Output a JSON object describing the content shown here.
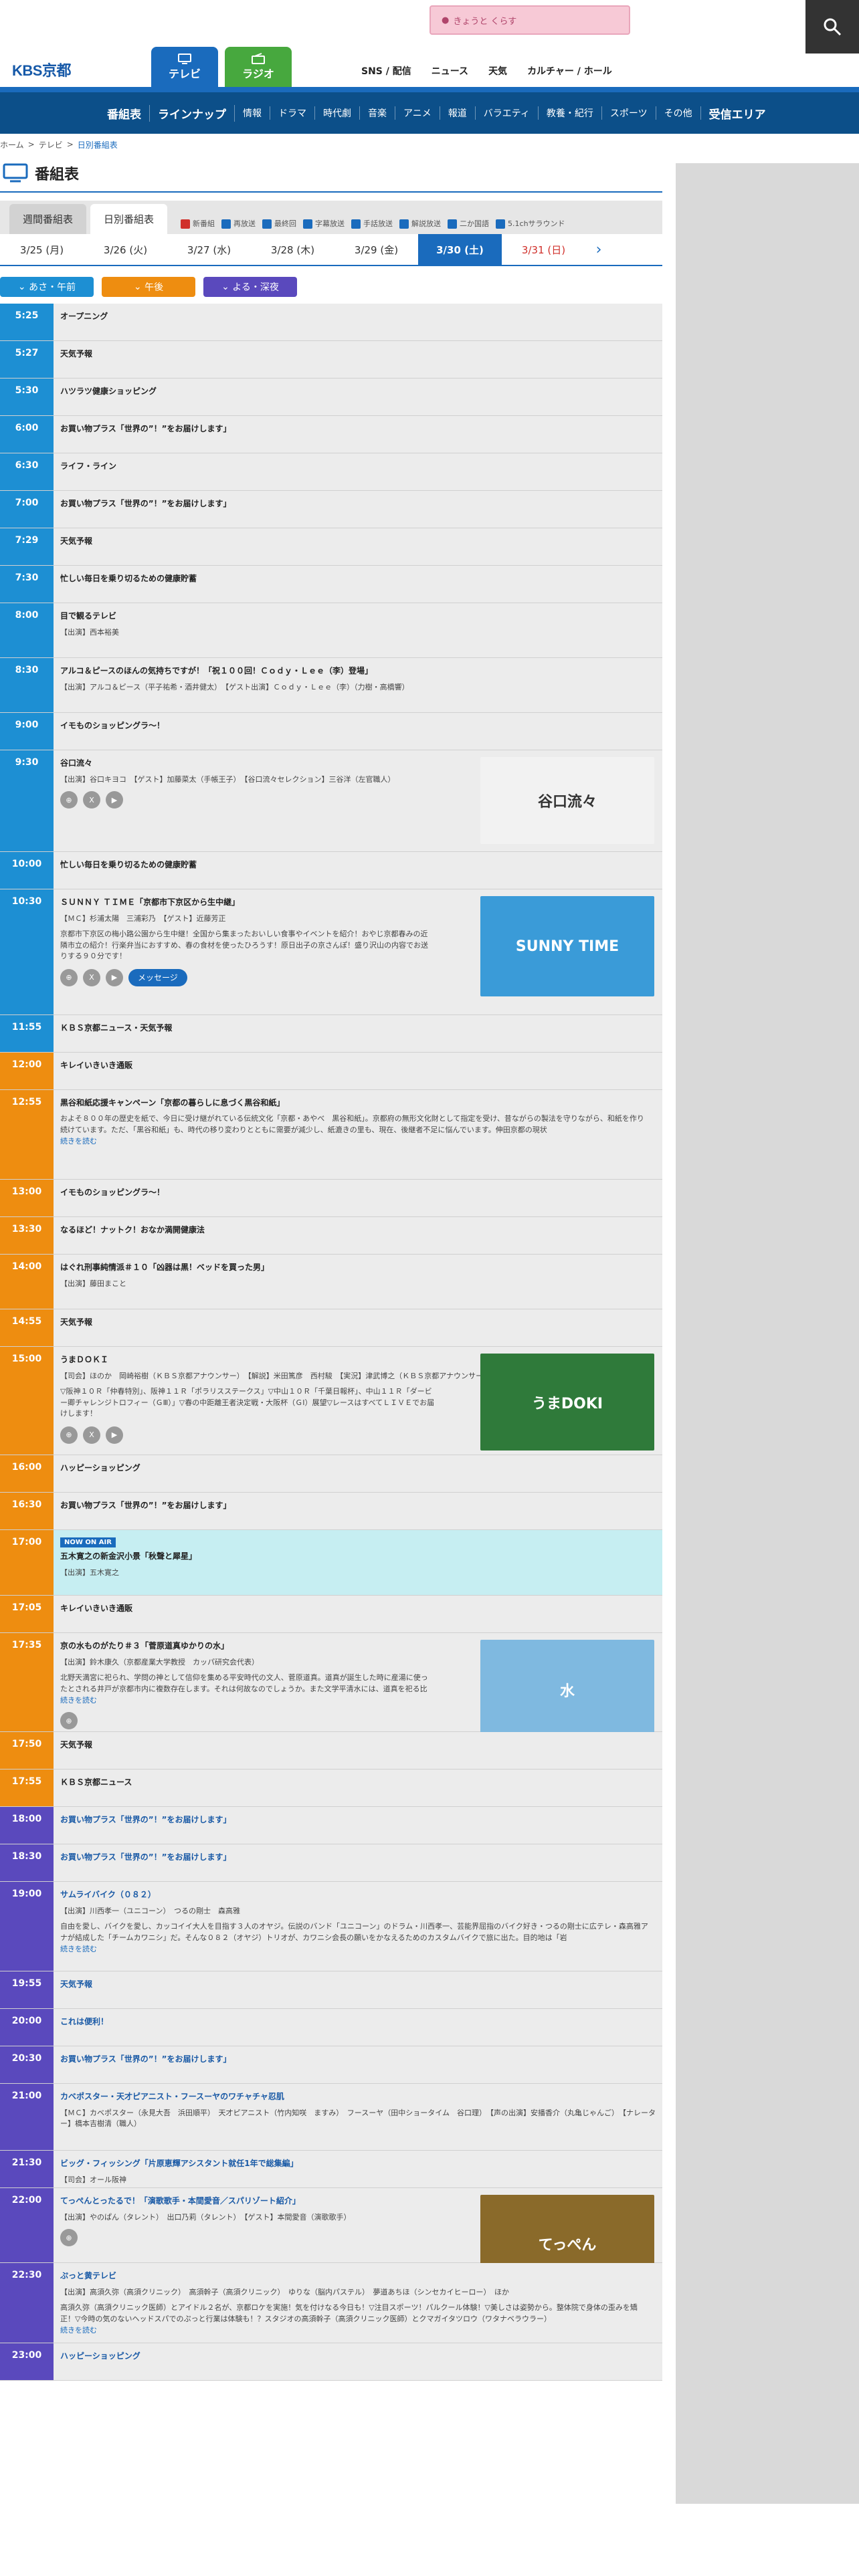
{
  "header": {
    "logo": "KBS京都",
    "promo": "きょうと くらす",
    "tab_tv": "テレビ",
    "tab_radio": "ラジオ",
    "nav": [
      "SNS / 配信",
      "ニュース",
      "天気",
      "カルチャー / ホール"
    ]
  },
  "menu": [
    "番組表",
    "ラインナップ",
    "情報",
    "ドラマ",
    "時代劇",
    "音楽",
    "アニメ",
    "報道",
    "バラエティ",
    "教養・紀行",
    "スポーツ",
    "その他",
    "受信エリア"
  ],
  "breadcrumb": [
    "ホーム",
    "テレビ",
    "日別番組表"
  ],
  "page_title": "番組表",
  "subtabs": [
    "週間番組表",
    "日別番組表"
  ],
  "legend": [
    "新番組",
    "再放送",
    "最終回",
    "字幕放送",
    "手話放送",
    "解説放送",
    "二か国語",
    "5.1chサラウンド"
  ],
  "dates": [
    "3/25 (月)",
    "3/26 (火)",
    "3/27 (水)",
    "3/28 (木)",
    "3/29 (金)",
    "3/30 (土)",
    "3/31 (日)"
  ],
  "filters": [
    "あさ・午前",
    "午後",
    "よる・深夜"
  ],
  "onair_label": "NOW ON AIR",
  "message_label": "メッセージ",
  "programs": [
    {
      "time": "5:25",
      "title": "オープニング"
    },
    {
      "time": "5:27",
      "title": "天気予報"
    },
    {
      "time": "5:30",
      "title": "ハツラツ健康ショッピング"
    },
    {
      "time": "6:00",
      "title": "お買い物プラス「世界の”！”をお届けします」"
    },
    {
      "time": "6:30",
      "title": "ライフ・ライン"
    },
    {
      "time": "7:00",
      "title": "お買い物プラス「世界の”！”をお届けします」"
    },
    {
      "time": "7:29",
      "title": "天気予報"
    },
    {
      "time": "7:30",
      "title": "忙しい毎日を乗り切るための健康貯蓄"
    },
    {
      "time": "8:00",
      "title": "目で観るテレビ",
      "cast": "【出演】西本裕美"
    },
    {
      "time": "8:30",
      "title": "アルコ＆ピースのほんの気持ちですが！「祝１００回！Ｃｏｄｙ・Ｌｅｅ（李）登場」",
      "cast": "【出演】アルコ＆ピース（平子祐希・酒井健太）　【ゲスト出演】Ｃｏｄｙ・Ｌｅｅ（李）（力樹・高橋響）"
    },
    {
      "time": "9:00",
      "title": "イモものショッピングラ～！"
    },
    {
      "time": "9:30",
      "title": "谷口流々",
      "cast": "【出演】谷口キヨコ　【ゲスト】加藤菜太（手帳王子）　【谷口流々セレクション】三谷洋（左官職人）",
      "thumb": "谷口流々"
    },
    {
      "time": "10:00",
      "title": "忙しい毎日を乗り切るための健康貯蓄"
    },
    {
      "time": "10:30",
      "title": "ＳＵＮＮＹ ＴＩＭＥ「京都市下京区から生中継」",
      "cast": "【ＭＣ】杉浦太陽　三浦彩乃　【ゲスト】近藤芳正",
      "desc": "京都市下京区の梅小路公園から生中継！全国から集まったおいしい食事やイベントを紹介！おやじ京都春みの近隣市立の紹介！行楽弁当におすすめ、春の食材を使ったひろうす！原日出子の京さんぽ！盛り沢山の内容でお送りする９０分です！",
      "thumb": "SUNNY TIME"
    },
    {
      "time": "11:55",
      "title": "ＫＢＳ京都ニュース・天気予報"
    },
    {
      "time": "12:00",
      "title": "キレイいきいき通販"
    },
    {
      "time": "12:55",
      "title": "黒谷和紙応援キャンペーン「京都の暮らしに息づく黒谷和紙」",
      "desc": "およそ８００年の歴史を紙で、今日に受け継がれている伝統文化「京都・あやべ　黒谷和紙」。京都府の無形文化財として指定を受け、昔ながらの製法を守りながら、和紙を作り続けています。ただ、「黒谷和紙」も、時代の移り変わりとともに需要が減少し、紙漉きの里も、現在、後継者不足に悩んでいます。伸田京都の現状",
      "more": "続きを読む",
      "wide": true
    },
    {
      "time": "13:00",
      "title": "イモものショッピングラ～！"
    },
    {
      "time": "13:30",
      "title": "なるほど！ナットク！おなか満開健康法"
    },
    {
      "time": "14:00",
      "title": "はぐれ刑事純情派＃１０「凶器は黒！ベッドを買った男」",
      "cast": "【出演】藤田まこと"
    },
    {
      "time": "14:55",
      "title": "天気予報"
    },
    {
      "time": "15:00",
      "title": "うまＤＯＫＩ",
      "cast": "【司会】ほのか　岡崎裕樹（ＫＢＳ京都アナウンサー）　【解説】米田篤彦　西村駿　【実況】津武博之（ＫＢＳ京都アナウンサー）　森谷優夫（ＫＢＳ京都アナウンサー）",
      "desc": "▽阪神１０Ｒ「仲春特別」、阪神１１Ｒ「ポラリスステークス」▽中山１０Ｒ「千葉日報杯」、中山１１Ｒ「ダービー卿チャレンジトロフィー（ＧⅢ）」▽春の中距離王者決定戦・大阪杯（ＧⅠ）展望▽レースはすべてＬＩＶＥでお届けします！",
      "thumb": "うまDOKI"
    },
    {
      "time": "16:00",
      "title": "ハッピーショッピング"
    },
    {
      "time": "16:30",
      "title": "お買い物プラス「世界の”！”をお届けします」"
    },
    {
      "time": "17:00",
      "title": "五木寛之の新金沢小景「秋聲と犀星」",
      "cast": "【出演】五木寛之",
      "onair": true
    },
    {
      "time": "17:05",
      "title": "キレイいきいき通販"
    },
    {
      "time": "17:35",
      "title": "京の水ものがたり＃３「菅原道真ゆかりの水」",
      "cast": "【出演】鈴木康久（京都産業大学教授　カッパ研究会代表）",
      "desc": "北野天満宮に祀られ、学問の神として信仰を集める平安時代の文人、菅原道真。道真が誕生した時に産湯に使ったとされる井戸が京都市内に複数存在します。それは何故なのでしょうか。また文学平清水には、道真を祀る比",
      "more": "続きを読む",
      "thumb": "水"
    },
    {
      "time": "17:50",
      "title": "天気予報"
    },
    {
      "time": "17:55",
      "title": "ＫＢＳ京都ニュース"
    },
    {
      "time": "18:00",
      "title": "お買い物プラス「世界の”！”をお届けします」"
    },
    {
      "time": "18:30",
      "title": "お買い物プラス「世界の”！”をお届けします」"
    },
    {
      "time": "19:00",
      "title": "サムライバイク（０８２）",
      "cast": "【出演】川西孝一（ユニコーン）　つるの剛士　森高雅",
      "desc": "自由を愛し、バイクを愛し、カッコイイ大人を目指す３人のオヤジ。伝説のバンド「ユニコーン」のドラム・川西孝一、芸能界屈指のバイク好き・つるの剛士に広テレ・森高雅アナが結成した「チームカワニシ」だ。そんな０８２（オヤジ）トリオが、カワニシ会長の願いをかなえるためのカスタムバイクで旅に出た。目的地は「岩",
      "more": "続きを読む",
      "wide": true
    },
    {
      "time": "19:55",
      "title": "天気予報"
    },
    {
      "time": "20:00",
      "title": "これは便利！"
    },
    {
      "time": "20:30",
      "title": "お買い物プラス「世界の”！”をお届けします」"
    },
    {
      "time": "21:00",
      "title": "カベポスター・天才ピアニスト・フースーヤのワチャチャ忍肌",
      "cast": "【ＭＣ】カベポスター（永見大吾　浜田順平）　天才ピアニスト（竹内知咲　ますみ）　フースーヤ（田中ショータイム　谷口理）　【声の出演】安播香介（丸亀じゃんご）　【ナレーター】橋本吉樹清（職人）"
    },
    {
      "time": "21:30",
      "title": "ビッグ・フィッシング「片原恵輝アシスタント就任1年で総集編」",
      "cast": "【司会】オール阪神"
    },
    {
      "time": "22:00",
      "title": "てっぺんとったるで！「演歌歌手・本間愛音／スパリゾート紹介」",
      "cast": "【出演】やのぱん（タレント）　出口乃莉（タレント）　【ゲスト】本間愛音（演歌歌手）",
      "thumb": "てっぺん"
    },
    {
      "time": "22:30",
      "title": "ぷっと黄テレビ",
      "cast": "【出演】高須久弥（高須クリニック）　高須幹子（高須クリニック）　ゆりな（脳内パステル）　夢道あちほ（シンセカイヒーロー）　ほか",
      "desc": "高須久弥（高須クリニック医師）とアイドル２名が、京都ロケを実施！気を付けなる今日も！▽注目スポーツ！パルクール体験！▽美しさは姿勢から。整体院で身体の歪みを矯正！▽今時の気のないヘッドスパでのぷっと行業は体験も！？スタジオの高須幹子（高須クリニック医師）とクマガイタツロウ（ワタナベラウラー）",
      "more": "続きを読む",
      "wide": true
    },
    {
      "time": "23:00",
      "title": "ハッピーショッピング"
    }
  ]
}
